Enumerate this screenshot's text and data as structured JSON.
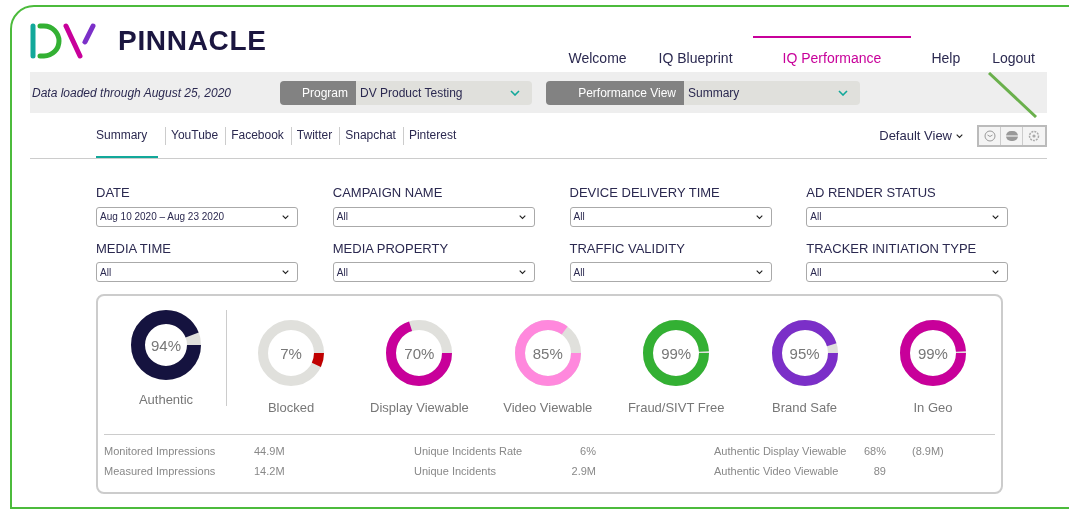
{
  "logo": {
    "name": "PINNACLE"
  },
  "nav": [
    {
      "label": "Welcome",
      "selected": false
    },
    {
      "label": "IQ Blueprint",
      "selected": false
    },
    {
      "label": "IQ Performance",
      "selected": true
    },
    {
      "label": "Help",
      "selected": false
    },
    {
      "label": "Logout",
      "selected": false
    }
  ],
  "data_loaded": "Data loaded through August 25, 2020",
  "selectors": [
    {
      "label": "Program",
      "value": "DV Product Testing"
    },
    {
      "label": "Performance View",
      "value": "Summary"
    }
  ],
  "tabs": [
    {
      "label": "Summary",
      "selected": true
    },
    {
      "label": "YouTube",
      "selected": false
    },
    {
      "label": "Facebook",
      "selected": false
    },
    {
      "label": "Twitter",
      "selected": false
    },
    {
      "label": "Snapchat",
      "selected": false
    },
    {
      "label": "Pinterest",
      "selected": false
    }
  ],
  "view_menu": "Default View",
  "filters": [
    {
      "label": "DATE",
      "value": "Aug 10 2020 – Aug 23 2020"
    },
    {
      "label": "CAMPAIGN NAME",
      "value": "All"
    },
    {
      "label": "DEVICE DELIVERY TIME",
      "value": "All"
    },
    {
      "label": "AD RENDER STATUS",
      "value": "All"
    },
    {
      "label": "MEDIA TIME",
      "value": "All"
    },
    {
      "label": "MEDIA PROPERTY",
      "value": "All"
    },
    {
      "label": "TRAFFIC VALIDITY",
      "value": "All"
    },
    {
      "label": "TRACKER INITIATION TYPE",
      "value": "All"
    }
  ],
  "metrics": [
    {
      "label": "Authentic",
      "reading": "94%",
      "color": "#15133f"
    },
    {
      "label": "Blocked",
      "reading": "7%",
      "color": "#c00000"
    },
    {
      "label": "Display Viewable",
      "reading": "70%",
      "color": "#c8009a"
    },
    {
      "label": "Video Viewable",
      "reading": "85%",
      "color": "#ff88dd"
    },
    {
      "label": "Fraud/SIVT Free",
      "reading": "99%",
      "color": "#33b033"
    },
    {
      "label": "Brand Safe",
      "reading": "95%",
      "color": "#7b2fc8"
    },
    {
      "label": "In Geo",
      "reading": "99%",
      "color": "#c8009a"
    }
  ],
  "stats": [
    [
      {
        "label": "Monitored Impressions",
        "value": "44.9M"
      },
      {
        "label": "Measured Impressions",
        "value": "14.2M"
      }
    ],
    [
      {
        "label": "Unique Incidents Rate",
        "value": "6%"
      },
      {
        "label": "Unique Incidents",
        "value": "2.9M"
      }
    ],
    [
      {
        "label": "Authentic Display Viewable",
        "value": "68%",
        "extra": "(8.9M)"
      },
      {
        "label": "Authentic Video Viewable",
        "value": "89"
      }
    ]
  ]
}
